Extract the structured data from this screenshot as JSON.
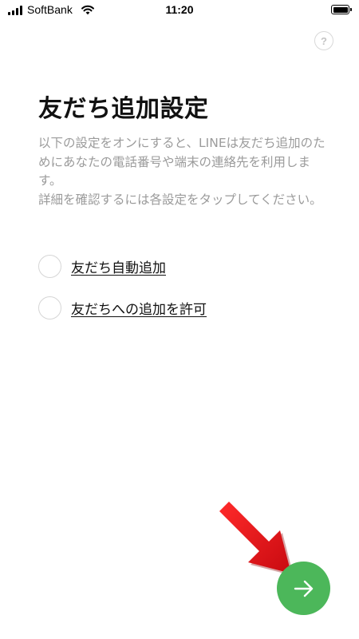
{
  "status_bar": {
    "carrier": "SoftBank",
    "time": "11:20",
    "signal_bars": 4,
    "battery_level": 1.0,
    "icons": [
      "signal-icon",
      "wifi-icon",
      "battery-icon"
    ]
  },
  "help": {
    "label": "?"
  },
  "page": {
    "title": "友だち追加設定",
    "description_1": "以下の設定をオンにすると、LINEは友だち追加のためにあなたの電話番号や端末の連絡先を利用します。",
    "description_2": "詳細を確認するには各設定をタップしてください。"
  },
  "options": [
    {
      "label": "友だち自動追加",
      "checked": false
    },
    {
      "label": "友だちへの追加を許可",
      "checked": false
    }
  ],
  "next_button": {
    "icon": "arrow-right-icon",
    "color": "#4cb75a"
  },
  "annotation": {
    "icon": "red-pointer-arrow-icon",
    "color": "#e8141b"
  }
}
